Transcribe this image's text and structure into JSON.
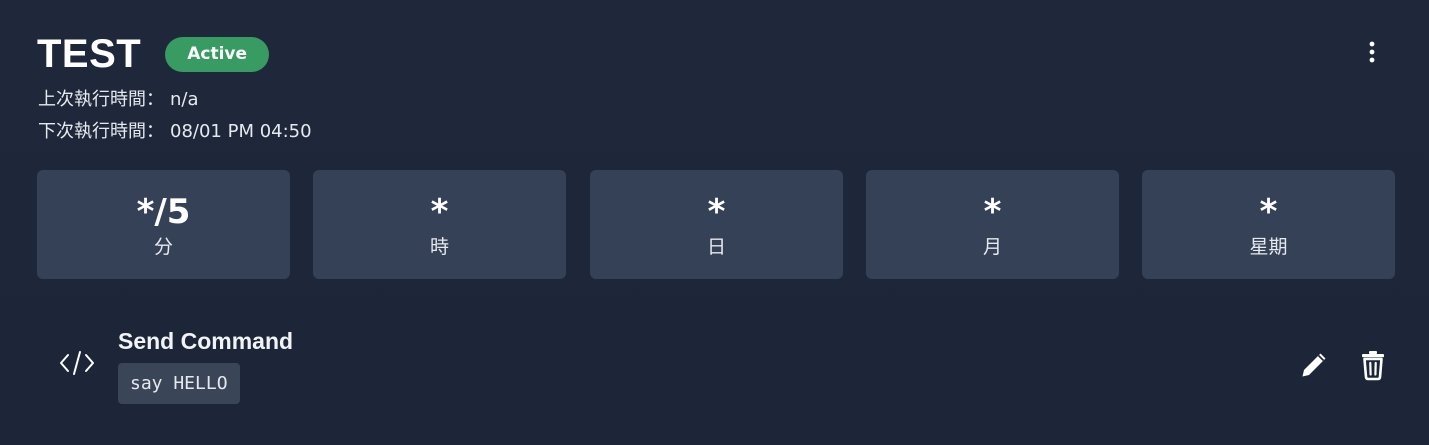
{
  "task": {
    "name": "TEST",
    "status": "Active",
    "status_color": "#389b62",
    "last_run_label": "上次執行時間：",
    "last_run_value": "n/a",
    "next_run_label": "下次執行時間：",
    "next_run_value": "08/01 PM 04:50",
    "menu_icon": "more-vertical-icon"
  },
  "schedule": {
    "fields": [
      {
        "value": "*/5",
        "label": "分"
      },
      {
        "value": "*",
        "label": "時"
      },
      {
        "value": "*",
        "label": "日"
      },
      {
        "value": "*",
        "label": "月"
      },
      {
        "value": "*",
        "label": "星期"
      }
    ]
  },
  "action": {
    "icon": "code-icon",
    "title": "Send Command",
    "command": "say HELLO",
    "edit_icon": "pencil-icon",
    "delete_icon": "trash-icon"
  },
  "colors": {
    "background": "#1e2739",
    "field_background": "#354156",
    "code_background": "#3a4558"
  }
}
